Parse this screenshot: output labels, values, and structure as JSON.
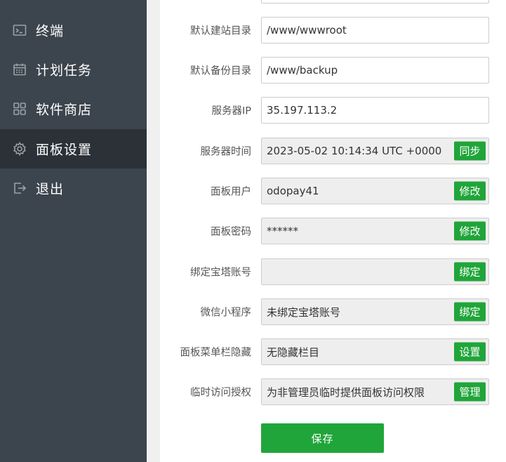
{
  "sidebar": {
    "items": [
      {
        "label": "终端",
        "icon": "terminal-icon"
      },
      {
        "label": "计划任务",
        "icon": "calendar-icon"
      },
      {
        "label": "软件商店",
        "icon": "grid-icon"
      },
      {
        "label": "面板设置",
        "icon": "gear-icon",
        "active": true
      },
      {
        "label": "退出",
        "icon": "logout-icon"
      }
    ],
    "active_bg": "#2c3138",
    "bg": "#3c444d"
  },
  "form": {
    "rows": [
      {
        "label": "默认建站目录",
        "value": "/www/wwwroot"
      },
      {
        "label": "默认备份目录",
        "value": "/www/backup"
      },
      {
        "label": "服务器IP",
        "value": "35.197.113.2"
      },
      {
        "label": "服务器时间",
        "value": "2023-05-02 10:14:34 UTC +0000",
        "button": "同步"
      },
      {
        "label": "面板用户",
        "value": "odopay41",
        "button": "修改"
      },
      {
        "label": "面板密码",
        "value": "******",
        "button": "修改"
      },
      {
        "label": "绑定宝塔账号",
        "value": "",
        "button": "绑定"
      },
      {
        "label": "微信小程序",
        "value": "未绑定宝塔账号",
        "button": "绑定"
      },
      {
        "label": "面板菜单栏隐藏",
        "value": "无隐藏栏目",
        "button": "设置"
      },
      {
        "label": "临时访问授权",
        "value": "为非管理员临时提供面板访问权限",
        "button": "管理"
      }
    ],
    "save_label": "保存",
    "accent": "#20a53a"
  }
}
